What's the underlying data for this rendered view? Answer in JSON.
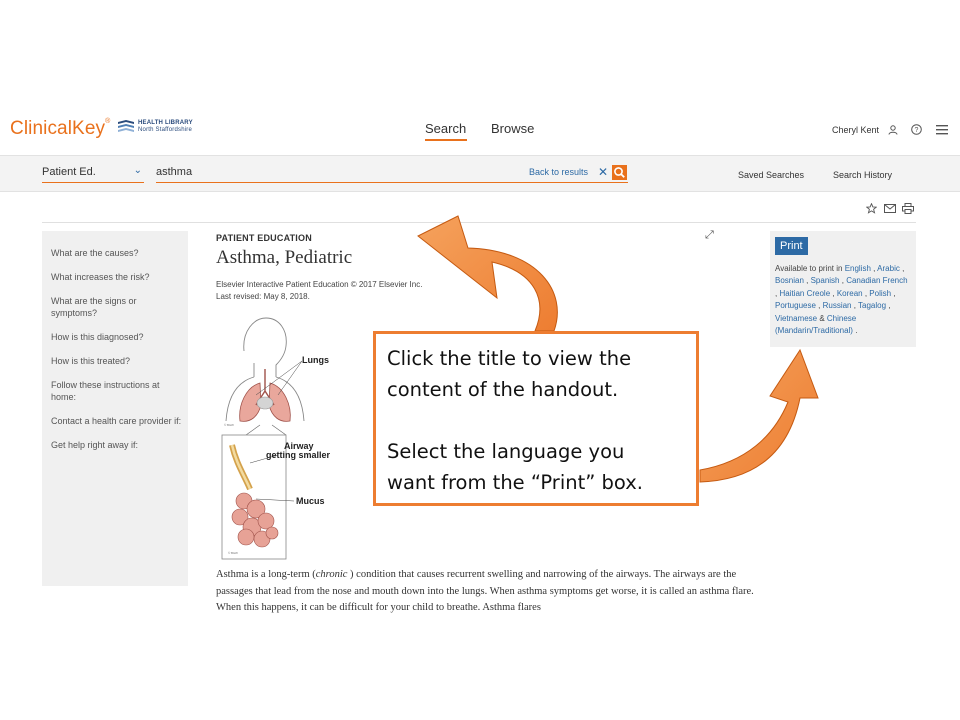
{
  "header": {
    "brand": "ClinicalKey",
    "brand_mark": "®",
    "library_line1": "HEALTH LIBRARY",
    "library_line2": "North Staffordshire",
    "nav": {
      "search": "Search",
      "browse": "Browse"
    },
    "user_name": "Cheryl Kent",
    "icons": [
      "user-icon",
      "help-icon",
      "menu-icon"
    ]
  },
  "search_bar": {
    "dropdown_value": "Patient Ed.",
    "query": "asthma",
    "back_link": "Back to results",
    "saved_searches": "Saved Searches",
    "search_history": "Search History"
  },
  "toolbar_icons": [
    "star-icon",
    "email-icon",
    "print-icon"
  ],
  "toc": [
    "What are the causes?",
    "What increases the risk?",
    "What are the signs or symptoms?",
    "How is this diagnosed?",
    "How is this treated?",
    "Follow these instructions at home:",
    "Contact a health care provider if:",
    "Get help right away if:"
  ],
  "article": {
    "kicker": "PATIENT EDUCATION",
    "title": "Asthma, Pediatric",
    "copyright": "Elsevier Interactive Patient Education © 2017 Elsevier Inc.",
    "revised": "Last revised: May 8, 2018.",
    "illustration_labels": {
      "lungs": "Lungs",
      "airway_1": "Airway",
      "airway_2": "getting smaller",
      "mucus": "Mucus"
    },
    "body_before": "Asthma is a long-term (",
    "body_italic": "chronic",
    "body_after": " ) condition that causes recurrent swelling and narrowing of the airways. The airways are the passages that lead from the nose and mouth down into the lungs. When asthma symptoms get worse, it is called an asthma flare. When this happens, it can be difficult for your child to breathe. Asthma flares"
  },
  "print_box": {
    "button": "Print",
    "available_prefix": "Available to print in",
    "languages": [
      "English",
      "Arabic",
      "Bosnian",
      "Spanish",
      "Canadian French",
      "Haitian Creole",
      "Korean",
      "Polish",
      "Portuguese",
      "Russian",
      "Tagalog",
      "Vietnamese",
      "Chinese (Mandarin/Traditional)"
    ],
    "separators": [
      " , ",
      " , ",
      " , ",
      " , ",
      " , ",
      " , ",
      " , ",
      " , ",
      " , ",
      " , ",
      " , ",
      " & ",
      " ."
    ]
  },
  "callout": {
    "line1": "Click the title to view the",
    "line2": "content of the handout.",
    "line3": "Select the language you",
    "line4": "want from the “Print” box."
  },
  "colors": {
    "brand_orange": "#e9711c",
    "link_blue": "#2d6aa5",
    "arrow_orange": "#ed7d31"
  }
}
